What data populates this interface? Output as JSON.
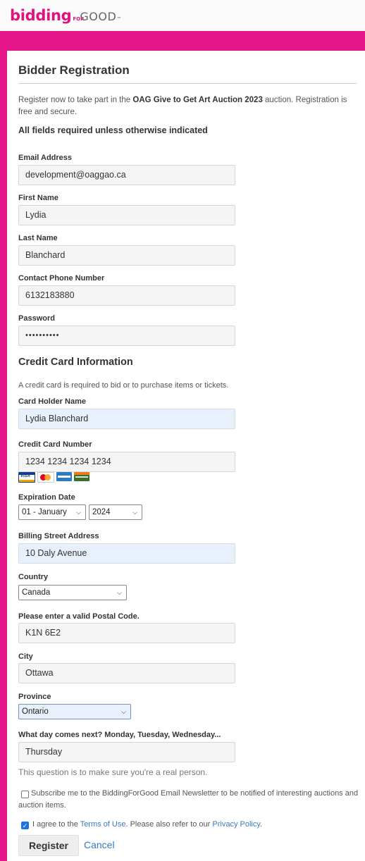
{
  "logo": {
    "brand_left": "bidding",
    "brand_mid": "FOR",
    "brand_right": "GOOD",
    "tm": "™"
  },
  "form": {
    "title": "Bidder Registration",
    "intro_pre": "Register now to take part in the ",
    "auction_name": "OAG Give to Get Art Auction 2023",
    "intro_post": " auction. Registration is free and secure.",
    "required_note": "All fields required unless otherwise indicated",
    "email_label": "Email Address",
    "email_value": "development@oaggao.ca",
    "first_label": "First Name",
    "first_value": "Lydia",
    "last_label": "Last Name",
    "last_value": "Blanchard",
    "phone_label": "Contact Phone Number",
    "phone_value": "6132183880",
    "password_label": "Password",
    "password_value": "••••••••••",
    "cc_heading": "Credit Card Information",
    "cc_note": "A credit card is required to bid or to purchase items or tickets.",
    "holder_label": "Card Holder Name",
    "holder_value": "Lydia Blanchard",
    "ccnum_label": "Credit Card Number",
    "ccnum_value": "1234 1234 1234 1234",
    "cards": [
      "VISA",
      "MasterCard",
      "AMEX",
      "Discover"
    ],
    "exp_label": "Expiration Date",
    "exp_month": "01 - January",
    "exp_year": "2024",
    "street_label": "Billing Street Address",
    "street_value": "10 Daly Avenue",
    "country_label": "Country",
    "country_value": "Canada",
    "postal_label": "Please enter a valid Postal Code.",
    "postal_value": "K1N 6E2",
    "city_label": "City",
    "city_value": "Ottawa",
    "province_label": "Province",
    "province_value": "Ontario",
    "question_label": "What day comes next? Monday, Tuesday, Wednesday...",
    "question_value": "Thursday",
    "question_note": "This question is to make sure you're a real person.",
    "subscribe_text": "Subscribe me to the BiddingForGood Email Newsletter to be notified of interesting auctions and auction items.",
    "subscribe_checked": false,
    "agree_pre": "I agree to the ",
    "terms_link": "Terms of Use",
    "agree_mid": ". Please also refer to our ",
    "privacy_link": "Privacy Policy",
    "agree_post": ".",
    "agree_checked": true,
    "register_label": "Register",
    "cancel_label": "Cancel"
  },
  "colors": {
    "brand_pink": "#e5168a",
    "link": "#3a78c2",
    "autofill_blue": "#e8f0fb"
  }
}
